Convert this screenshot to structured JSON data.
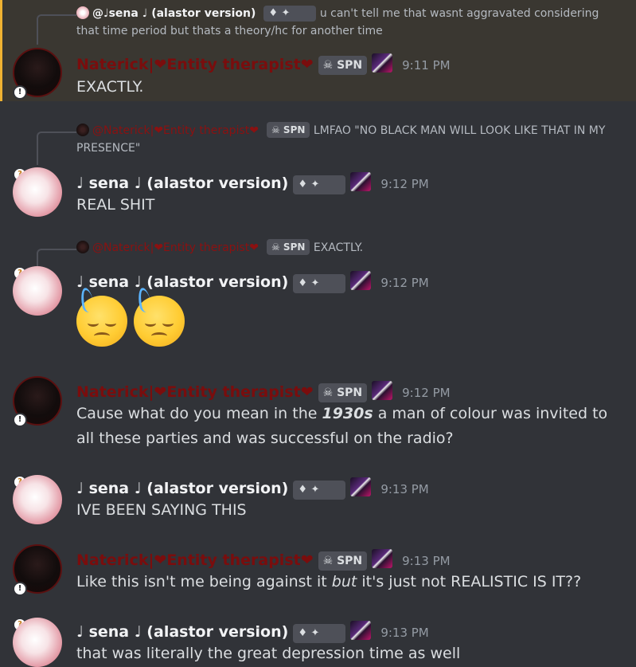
{
  "messages": [
    {
      "reply": {
        "name": "@♩sena ♩ (alastor version)",
        "badge": "♦ ✦",
        "text": "u can't tell me that wasnt aggravated considering that time period but thats a theory/hc for another time"
      },
      "author": "Naterick|❤Entity therapist❤",
      "tag": "SPN",
      "time": "9:11 PM",
      "body": "EXACTLY."
    },
    {
      "reply": {
        "name": "@Naterick|❤Entity therapist❤",
        "tag": "SPN",
        "text": "LMFAO \"NO BLACK MAN WILL LOOK LIKE THAT IN MY PRESENCE\""
      },
      "author": "♩ sena ♩ (alastor version)",
      "badge": "♦ ✦",
      "time": "9:12 PM",
      "body": "REAL SHIT"
    },
    {
      "reply": {
        "name": "@Naterick|❤Entity therapist❤",
        "tag": "SPN",
        "text": "EXACTLY."
      },
      "author": "♩ sena ♩ (alastor version)",
      "badge": "♦ ✦",
      "time": "9:12 PM",
      "emoji": [
        "sweat-smile",
        "sweat-smile"
      ]
    },
    {
      "author": "Naterick|❤Entity therapist❤",
      "tag": "SPN",
      "time": "9:12 PM",
      "body_pre": "Cause what do you mean in the ",
      "body_em": "1930s",
      "body_post": " a man of colour was invited to all these parties and was successful on the radio?"
    },
    {
      "author": "♩ sena ♩ (alastor version)",
      "badge": "♦ ✦",
      "time": "9:13 PM",
      "body": "IVE BEEN SAYING THIS"
    },
    {
      "author": "Naterick|❤Entity therapist❤",
      "tag": "SPN",
      "time": "9:13 PM",
      "body_pre": "Like this isn't me being against it ",
      "body_em": "but",
      "body_post": " it's just not REALISTIC IS IT??"
    },
    {
      "author": "♩ sena ♩ (alastor version)",
      "badge": "♦ ✦",
      "time": "9:13 PM",
      "body": "that was literally the great depression time as well"
    }
  ],
  "colors": {
    "background": "#313338",
    "highlight": "#3a3731",
    "highlight_bar": "#f0b232",
    "red_name": "#7a0d0d",
    "tag_bg": "#4e5058",
    "timestamp": "#949ba4"
  }
}
